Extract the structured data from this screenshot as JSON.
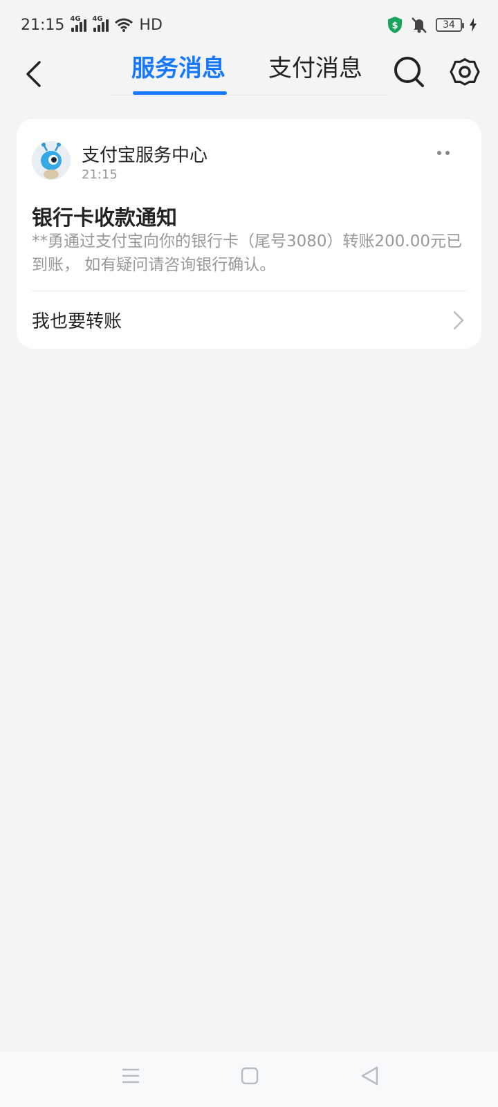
{
  "status_bar": {
    "time": "21:15",
    "net1": "4G",
    "net2": "4G",
    "hd": "HD",
    "battery": "34"
  },
  "nav": {
    "tabs": [
      {
        "label": "服务消息",
        "active": true
      },
      {
        "label": "支付消息",
        "active": false
      }
    ],
    "accent_color": "#1677ff"
  },
  "message": {
    "sender": "支付宝服务中心",
    "time": "21:15",
    "title": "银行卡收款通知",
    "body": "**勇通过支付宝向你的银行卡（尾号3080）转账200.00元已到账， 如有疑问请咨询银行确认。",
    "action_label": "我也要转账"
  },
  "icons": {
    "back": "chevron-left-icon",
    "search": "search-icon",
    "settings": "gear-icon",
    "more": "more-dots-icon",
    "action": "chevron-right-icon"
  }
}
